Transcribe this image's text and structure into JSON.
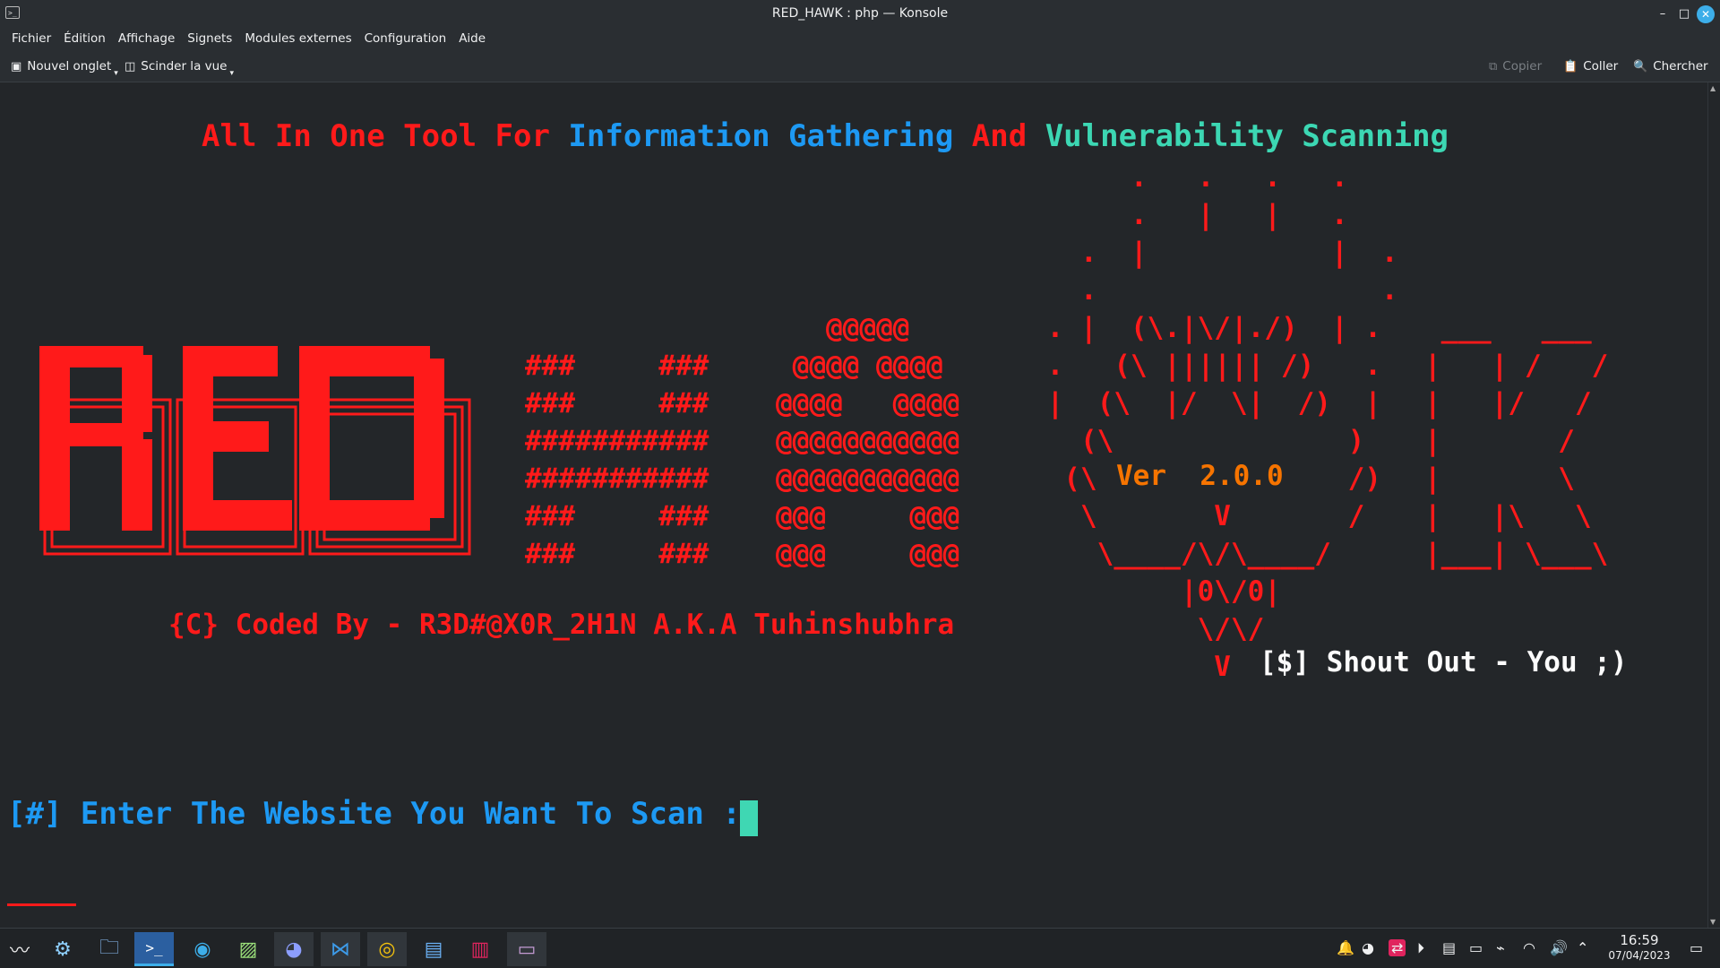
{
  "window": {
    "title": "RED_HAWK : php — Konsole",
    "min": "–",
    "max": "□",
    "close": "✕"
  },
  "menu": [
    "Fichier",
    "Édition",
    "Affichage",
    "Signets",
    "Modules externes",
    "Configuration",
    "Aide"
  ],
  "toolbar": {
    "new_tab": "Nouvel onglet",
    "split_view": "Scinder la vue",
    "copy": "Copier",
    "paste": "Coller",
    "find": "Chercher"
  },
  "terminal": {
    "headline": {
      "w1": "All In One Tool For",
      "w2": "Information Gathering",
      "w3": "And",
      "w4": "Vulnerability Scanning"
    },
    "red_art": [
      "RED"
    ],
    "hash_art": [
      "###     ###",
      "###     ###",
      "###########",
      "###########",
      "###     ###",
      "###     ###"
    ],
    "at_art": [
      "   @@@@@",
      " @@@@ @@@@",
      "@@@@   @@@@",
      "@@@@@@@@@@@",
      "@@@@@@@@@@@",
      "@@@     @@@",
      "@@@     @@@"
    ],
    "hawk_art": [
      "      .   .   .   .",
      "      .   |   |   .",
      "   .  |           |  .",
      "   .                 .",
      " . |  (\\.|\\/|./)  | .",
      " .   (\\ |||||| /)   .",
      " |  (\\  |/  \\|  /)  |",
      "   (\\              )",
      "  (\\               /)",
      "   \\       V       /",
      "    \\____/\\/\\____/",
      "         |0\\/0|",
      "          \\/\\/",
      "           V"
    ],
    "version_label": "Ver  2.0.0",
    "k_art": [
      " ___   ___",
      "|   | /   /",
      "|   |/   /",
      "|       /",
      "|       \\",
      "|   |\\   \\",
      "|___| \\___\\"
    ],
    "credit": "{C} Coded By - R3D#@X0R_2H1N A.K.A Tuhinshubhra",
    "shout_out": "[$] Shout Out - You ;)",
    "prompt_tag": "[#]",
    "prompt_text": "Enter The Website You Want To Scan :"
  },
  "taskbar": {
    "apps": [
      "kali-menu-icon",
      "settings-icon",
      "files-icon",
      "terminal-icon",
      "system-monitor-icon",
      "image-viewer-icon",
      "discord-icon",
      "vscode-icon",
      "chrome-icon",
      "document-icon",
      "text-editor-icon",
      "screenshot-icon"
    ],
    "time": "16:59",
    "date": "07/04/2023"
  },
  "colors": {
    "red": "#ff1a1a",
    "blue": "#1d99f3",
    "teal": "#3cd7b3",
    "orange": "#f67400",
    "background": "#232629"
  }
}
